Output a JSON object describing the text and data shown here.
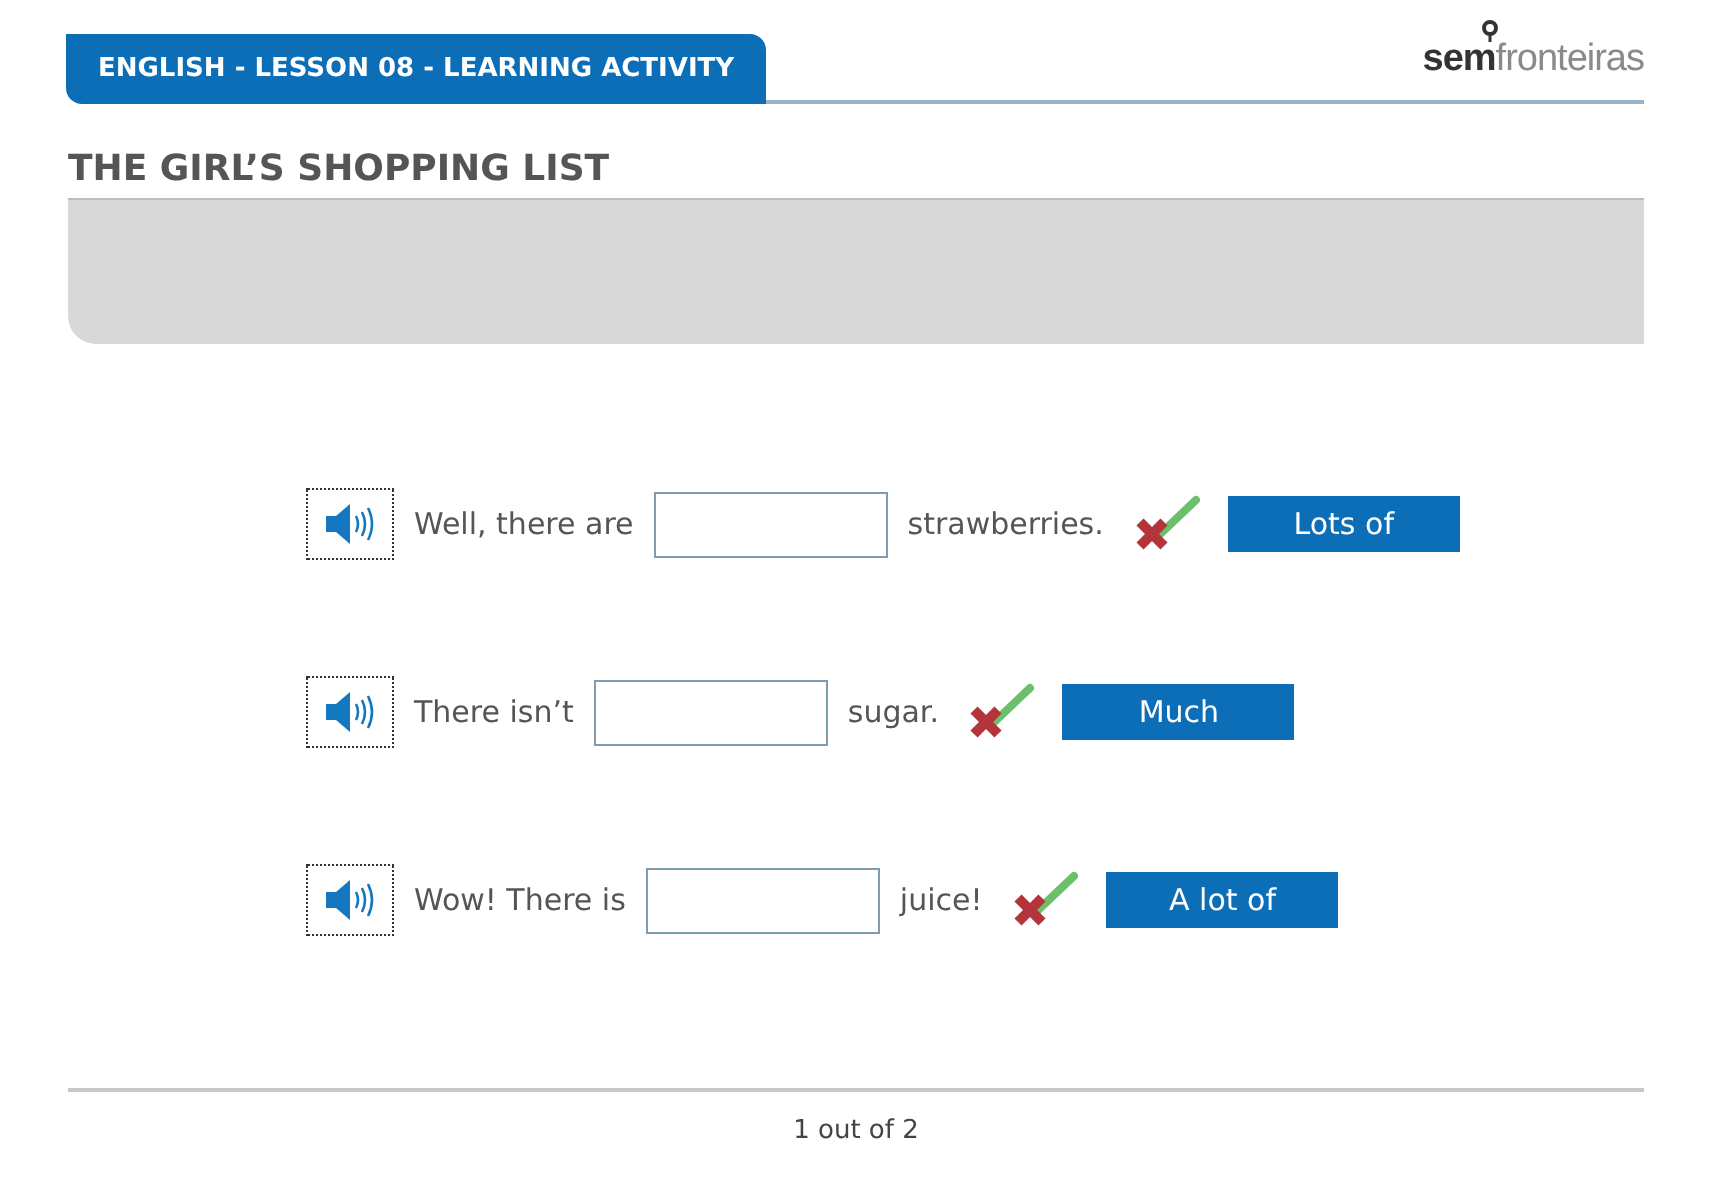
{
  "header": {
    "tab": "ENGLISH - LESSON 08 - LEARNING ACTIVITY",
    "logo": "**sem**fronteiras"
  },
  "title": "THE GIRL’S SHOPPING LIST",
  "rows": [
    {
      "before": "Well, there are",
      "after": "strawberries.",
      "answer": "Lots of"
    },
    {
      "before": "There isn’t",
      "after": "sugar.",
      "answer": "Much"
    },
    {
      "before": "Wow! There is",
      "after": "juice!",
      "answer": "A lot of"
    }
  ],
  "pager": "1 out of 2"
}
